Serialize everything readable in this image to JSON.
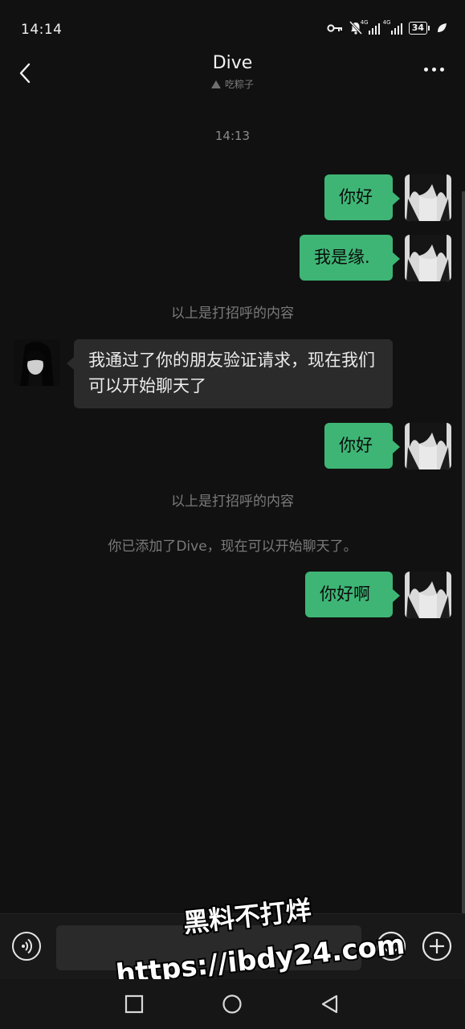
{
  "status": {
    "time": "14:14",
    "signal_1": "4G",
    "signal_2": "4G",
    "battery": "34"
  },
  "header": {
    "title": "Dive",
    "subtitle": "吃粽子"
  },
  "messages": {
    "timestamp": "14:13",
    "out_1": "你好",
    "out_2": "我是缘.",
    "sys_1": "以上是打招呼的内容",
    "in_1": "我通过了你的朋友验证请求，现在我们可以开始聊天了",
    "out_3": "你好",
    "sys_2": "以上是打招呼的内容",
    "sys_3": "你已添加了Dive，现在可以开始聊天了。",
    "out_4": "你好啊"
  },
  "input": {
    "value": ""
  },
  "watermark": {
    "line1": "黑料不打烊",
    "line2": "https://ibdy24.com"
  },
  "colors": {
    "bubble_out": "#3eb575",
    "bubble_in": "#2b2b2b",
    "background": "#111111"
  },
  "icons": [
    "back-arrow",
    "more-dots",
    "voice",
    "emoji",
    "plus",
    "square",
    "circle",
    "triangle-back"
  ]
}
